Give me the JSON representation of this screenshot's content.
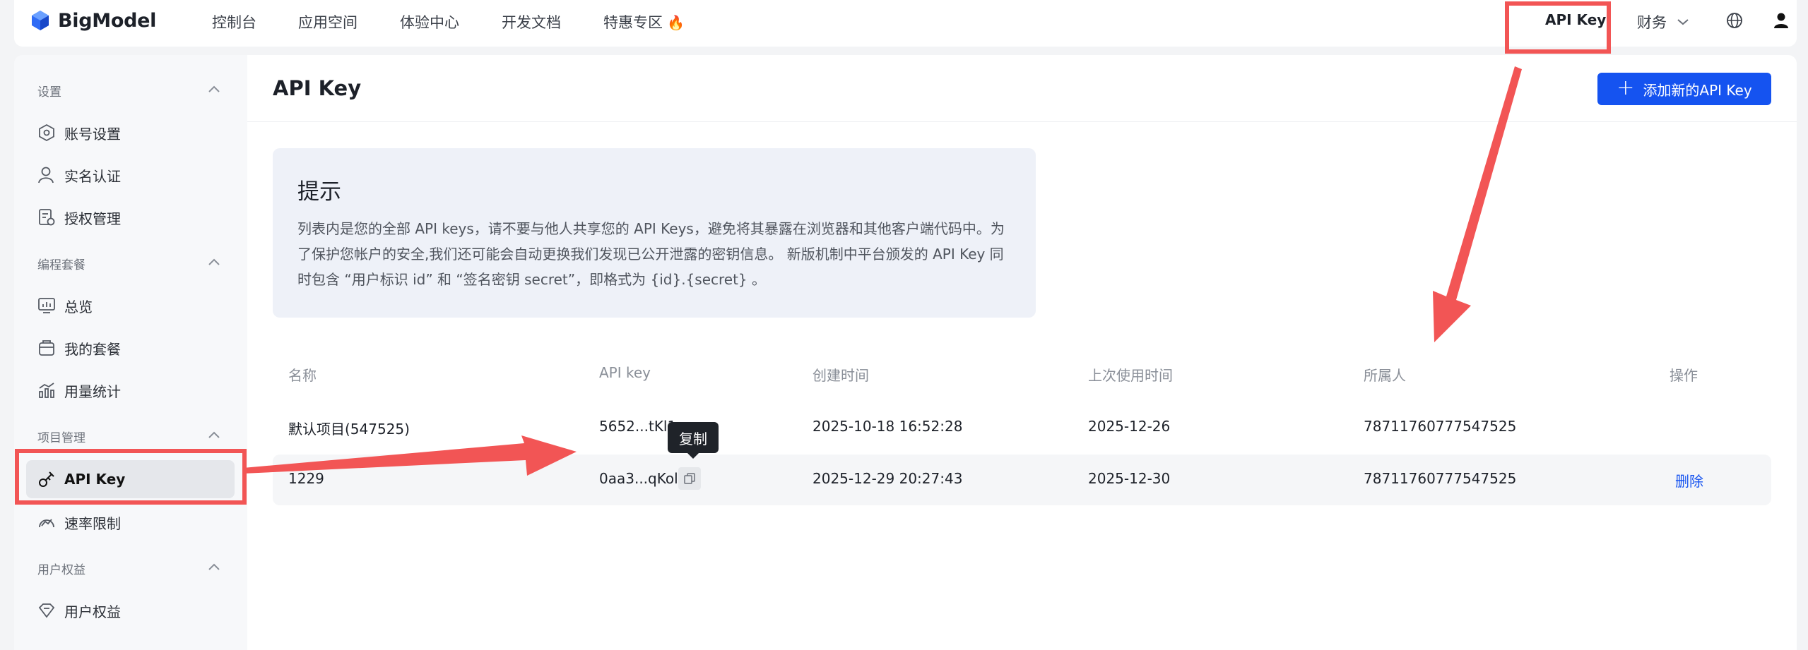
{
  "brand": {
    "name": "BigModel"
  },
  "topnav": {
    "items": [
      "控制台",
      "应用空间",
      "体验中心",
      "开发文档",
      "特惠专区"
    ],
    "api_key": "API Key",
    "finance": "财务"
  },
  "sidebar": {
    "groups": [
      {
        "title": "设置",
        "items": [
          "账号设置",
          "实名认证",
          "授权管理"
        ]
      },
      {
        "title": "编程套餐",
        "items": [
          "总览",
          "我的套餐",
          "用量统计"
        ]
      },
      {
        "title": "项目管理",
        "items": [
          "API Key",
          "速率限制"
        ]
      },
      {
        "title": "用户权益",
        "items": [
          "用户权益"
        ]
      }
    ],
    "active": "API Key"
  },
  "main": {
    "title": "API Key",
    "add_button": "添加新的API Key",
    "tip": {
      "title": "提示",
      "body": "列表内是您的全部 API keys，请不要与他人共享您的 API Keys，避免将其暴露在浏览器和其他客户端代码中。为了保护您帐户的安全,我们还可能会自动更换我们发现已公开泄露的密钥信息。 新版机制中平台颁发的 API Key 同时包含 “用户标识 id” 和 “签名密钥 secret”，即格式为 {id}.{secret} 。"
    },
    "table": {
      "headers": [
        "名称",
        "API key",
        "创建时间",
        "上次使用时间",
        "所属人",
        "操作"
      ],
      "rows": [
        {
          "name": "默认项目(547525)",
          "key": "5652...tKl1",
          "created": "2025-10-18 16:52:28",
          "last_used": "2025-12-26",
          "owner": "78711760777547525",
          "action": ""
        },
        {
          "name": "1229",
          "key": "0aa3...qKol",
          "created": "2025-12-29 20:27:43",
          "last_used": "2025-12-30",
          "owner": "78711760777547525",
          "action": "删除"
        }
      ]
    },
    "tooltip": "复制"
  },
  "colors": {
    "accent": "#1553f0",
    "annotation": "#f25555"
  }
}
